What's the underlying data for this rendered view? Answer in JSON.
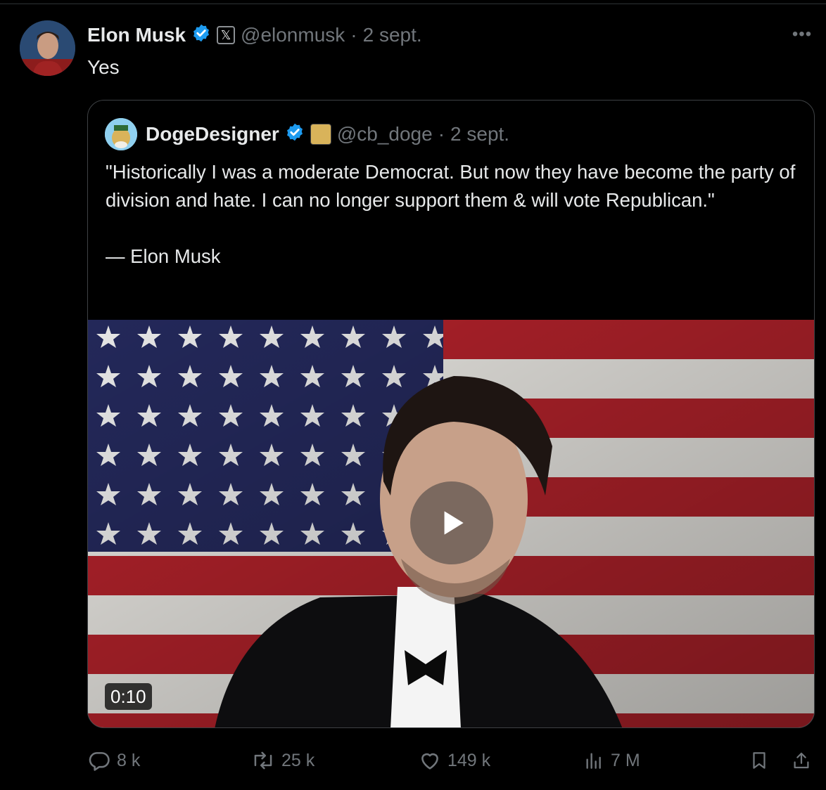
{
  "author": {
    "name": "Elon Musk",
    "handle": "@elonmusk",
    "separator": "·",
    "date": "2 sept.",
    "badge_icon": "verified-badge-icon",
    "affiliation_icon": "x-logo-icon"
  },
  "tweet": {
    "text": "Yes"
  },
  "quoted": {
    "name": "DogeDesigner",
    "handle": "@cb_doge",
    "separator": "·",
    "date": "2 sept.",
    "text": "\"Historically I was a moderate Democrat. But now they have become the party of division and hate. I can no longer support them & will vote Republican.\"",
    "attribution": "— Elon Musk",
    "media": {
      "type": "video",
      "duration": "0:10",
      "play_icon": "play-icon"
    }
  },
  "actions": {
    "replies": "8 k",
    "reposts": "25 k",
    "likes": "149 k",
    "views": "7 M"
  },
  "colors": {
    "background": "#000000",
    "text": "#e7e9ea",
    "secondary": "#71767b",
    "verified": "#1d9bf0"
  }
}
